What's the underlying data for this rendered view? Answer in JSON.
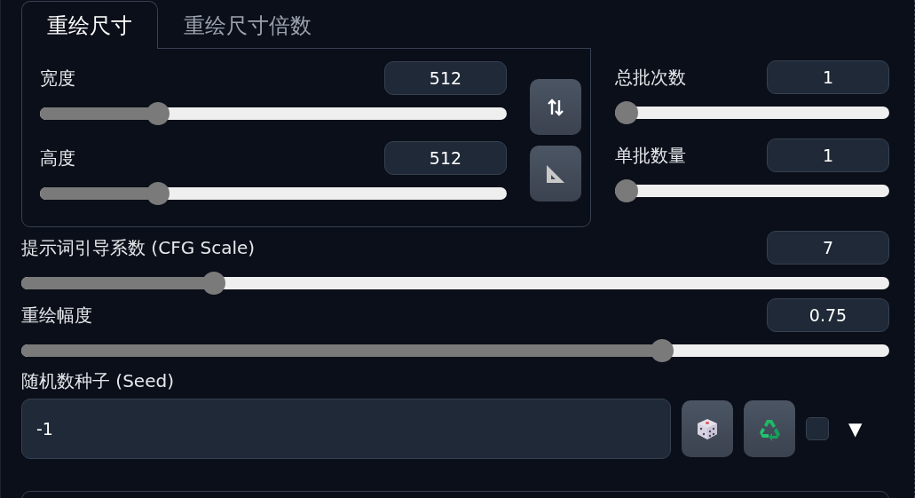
{
  "tabs": [
    {
      "label": "重绘尺寸",
      "selected": true
    },
    {
      "label": "重绘尺寸倍数",
      "selected": false
    }
  ],
  "size_sliders": [
    {
      "label": "宽度",
      "value": "512",
      "level": 0.24
    },
    {
      "label": "高度",
      "value": "512",
      "level": 0.24
    }
  ],
  "batch_sliders": [
    {
      "label": "总批次数",
      "value": "1",
      "level": 0
    },
    {
      "label": "单批数量",
      "value": "1",
      "level": 0
    }
  ],
  "wide_sliders": [
    {
      "label": "提示词引导系数 (CFG Scale)",
      "value": "7",
      "level": 0.214
    },
    {
      "label": "重绘幅度",
      "value": "0.75",
      "level": 0.745
    }
  ],
  "seed": {
    "label": "随机数种子 (Seed)",
    "value": "-1",
    "extra_checked": false,
    "expand_glyph": "▼"
  }
}
